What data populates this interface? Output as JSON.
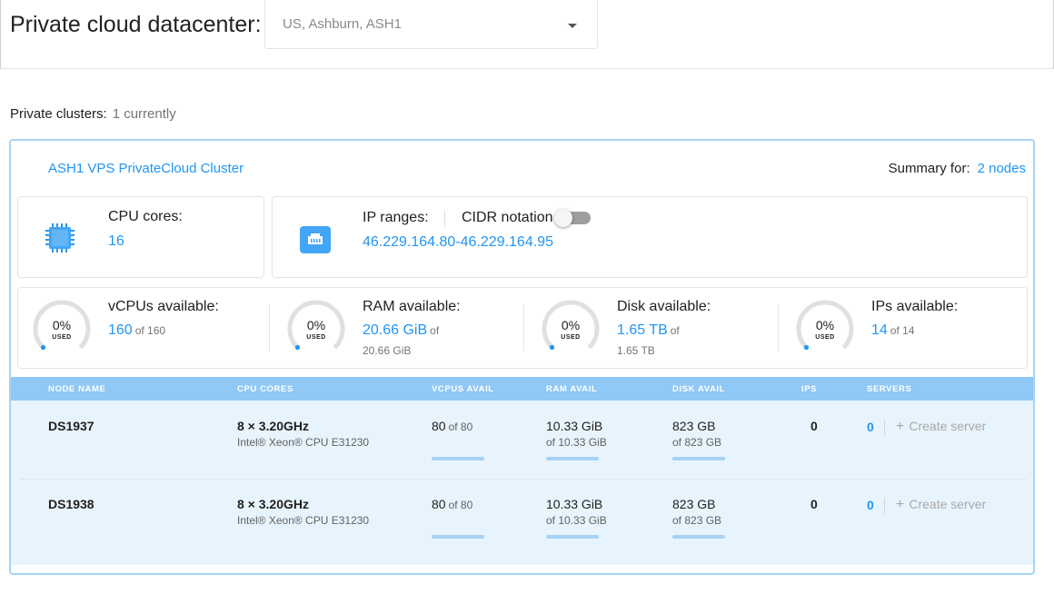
{
  "header": {
    "title": "Private cloud datacenter:",
    "datacenter_select": "US, Ashburn, ASH1"
  },
  "clusters": {
    "label": "Private clusters:",
    "count_text": "1 currently"
  },
  "cluster": {
    "name": "ASH1 VPS PrivateCloud Cluster",
    "summary_label": "Summary for:",
    "summary_value": "2 nodes",
    "cpu": {
      "label": "CPU cores:",
      "value": "16",
      "icon": "cpu-chip-icon"
    },
    "ip": {
      "label": "IP ranges:",
      "cidr_label": "CIDR notation",
      "cidr_enabled": false,
      "value": "46.229.164.80-46.229.164.95",
      "icon": "network-port-icon"
    },
    "availability": [
      {
        "pct": "0%",
        "used_label": "USED",
        "used_fraction": 0.0,
        "title": "vCPUs available:",
        "value": "160",
        "of": "of 160",
        "total": ""
      },
      {
        "pct": "0%",
        "used_label": "USED",
        "used_fraction": 0.0,
        "title": "RAM available:",
        "value": "20.66 GiB",
        "of": "of",
        "total": "20.66 GiB"
      },
      {
        "pct": "0%",
        "used_label": "USED",
        "used_fraction": 0.0,
        "title": "Disk available:",
        "value": "1.65 TB",
        "of": "of",
        "total": "1.65 TB"
      },
      {
        "pct": "0%",
        "used_label": "USED",
        "used_fraction": 0.0,
        "title": "IPs available:",
        "value": "14",
        "of": "of 14",
        "total": ""
      }
    ]
  },
  "table": {
    "columns": [
      "NODE NAME",
      "CPU CORES",
      "VCPUS AVAIL",
      "RAM AVAIL",
      "DISK AVAIL",
      "IPS",
      "SERVERS"
    ],
    "rows": [
      {
        "node": "DS1937",
        "cpu": "8 × 3.20GHz",
        "cpu_model": "Intel® Xeon® CPU E31230",
        "vcpus": "80",
        "vcpus_of": "of 80",
        "ram": "10.33 GiB",
        "ram_of": "of 10.33 GiB",
        "disk": "823 GB",
        "disk_of": "of 823 GB",
        "ips": "0",
        "servers": "0",
        "create_label": "Create server"
      },
      {
        "node": "DS1938",
        "cpu": "8 × 3.20GHz",
        "cpu_model": "Intel® Xeon® CPU E31230",
        "vcpus": "80",
        "vcpus_of": "of 80",
        "ram": "10.33 GiB",
        "ram_of": "of 10.33 GiB",
        "disk": "823 GB",
        "disk_of": "of 823 GB",
        "ips": "0",
        "servers": "0",
        "create_label": "Create server"
      }
    ]
  },
  "colors": {
    "accent": "#2196f3",
    "table_header": "#90c8f6",
    "table_body": "#e8f4fd",
    "card_border": "#a8d4f5"
  }
}
